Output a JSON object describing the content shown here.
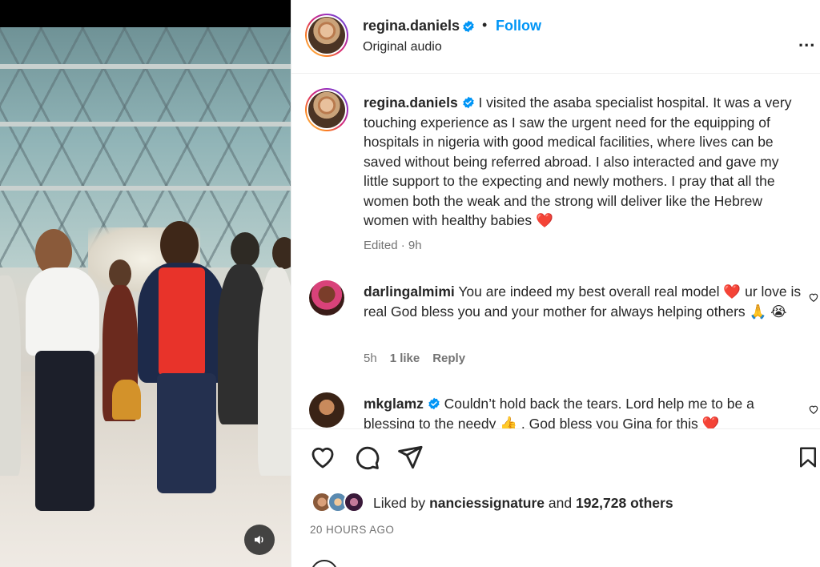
{
  "header": {
    "username": "regina.daniels",
    "separator": "•",
    "follow_label": "Follow",
    "subtitle": "Original audio",
    "more_label": "..."
  },
  "caption": {
    "username": "regina.daniels",
    "text": "I visited the asaba specialist hospital. It was a very touching experience as I saw the urgent need for the equipping of hospitals in nigeria with good medical facilities, where lives can be saved without being referred abroad. I also interacted and gave my little support to the expecting and newly mothers. I pray that all the women both the weak and the strong will deliver like the Hebrew women with healthy babies",
    "emoji": "❤️",
    "meta": "Edited · 9h"
  },
  "comments": [
    {
      "username": "darlingalmimi",
      "text_before": "You are indeed my best overall real model",
      "emoji_1": "❤️",
      "text_after": "ur love is real God bless you and your mother for always helping others",
      "emoji_2": "🙏 😭",
      "time": "5h",
      "likes": "1 like",
      "reply": "Reply"
    },
    {
      "username": "mkglamz",
      "text": "Couldn’t hold back the tears. Lord help me to be a blessing to the needy 👍 . God bless you Gina for this ❤️"
    }
  ],
  "likes": {
    "prefix": "Liked by",
    "user": "nanciessignature",
    "middle": "and",
    "count": "192,728 others"
  },
  "timestamp": "20 HOURS AGO",
  "icons": {
    "like": "heart-icon",
    "comment": "comment-icon",
    "share": "send-icon",
    "save": "bookmark-icon",
    "mute": "speaker-icon",
    "verified": "verified-badge-icon"
  },
  "colors": {
    "follow_blue": "#0095f6",
    "verified_blue": "#0095f6",
    "heart_red": "#ed2b2b",
    "muted_text": "#737373"
  }
}
